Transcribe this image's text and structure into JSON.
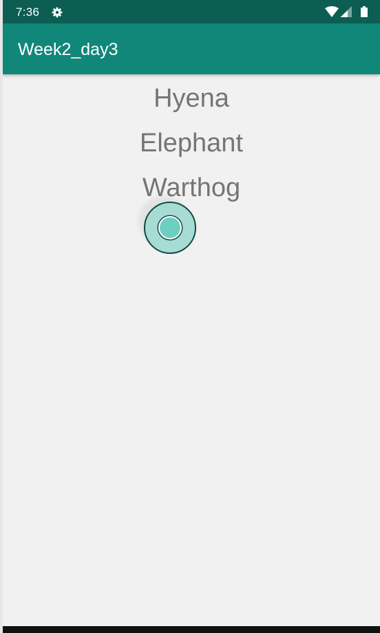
{
  "status_bar": {
    "time": "7:36",
    "icons": [
      "gear-icon",
      "wifi-icon",
      "cellular-signal-icon",
      "battery-icon"
    ]
  },
  "app_bar": {
    "title": "Week2_day3"
  },
  "animals": [
    "Hyena",
    "Elephant",
    "Warthog"
  ],
  "colors": {
    "status_bar": "#0c5e53",
    "app_bar": "#11877a",
    "background": "#f1f1f1",
    "list_text": "#757575",
    "touch_indicator": "#6ccfc2"
  }
}
